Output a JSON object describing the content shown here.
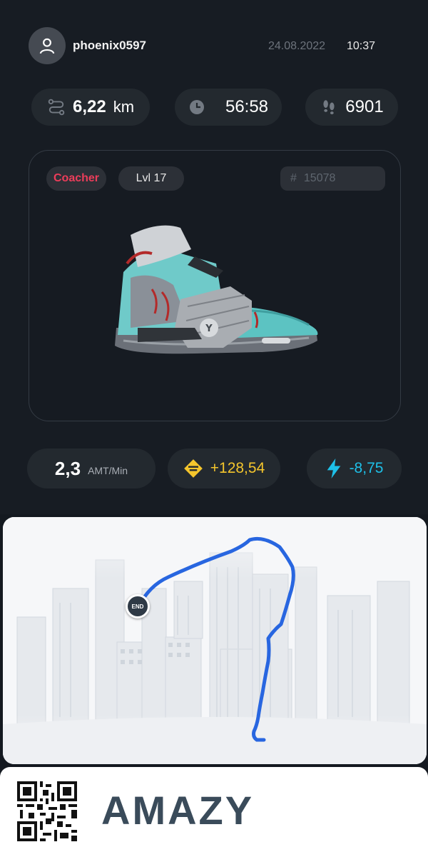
{
  "header": {
    "username": "phoenix0597",
    "date": "24.08.2022",
    "time": "10:37"
  },
  "stats": {
    "distance_value": "6,22",
    "distance_unit": "km",
    "duration": "56:58",
    "steps": "6901"
  },
  "sneaker": {
    "type": "Coacher",
    "level": "Lvl 17",
    "id_hash": "#",
    "id_number": "15078"
  },
  "earnings": {
    "rate_value": "2,3",
    "rate_unit": "AMT/Min",
    "gain": "+128,54",
    "energy": "-8,75"
  },
  "map": {
    "end_marker": "END"
  },
  "footer": {
    "brand": "AMAZY"
  },
  "colors": {
    "coacher": "#ec3d5a",
    "gain": "#f4c52c",
    "energy": "#1ec0e8",
    "route": "#2866e0"
  }
}
